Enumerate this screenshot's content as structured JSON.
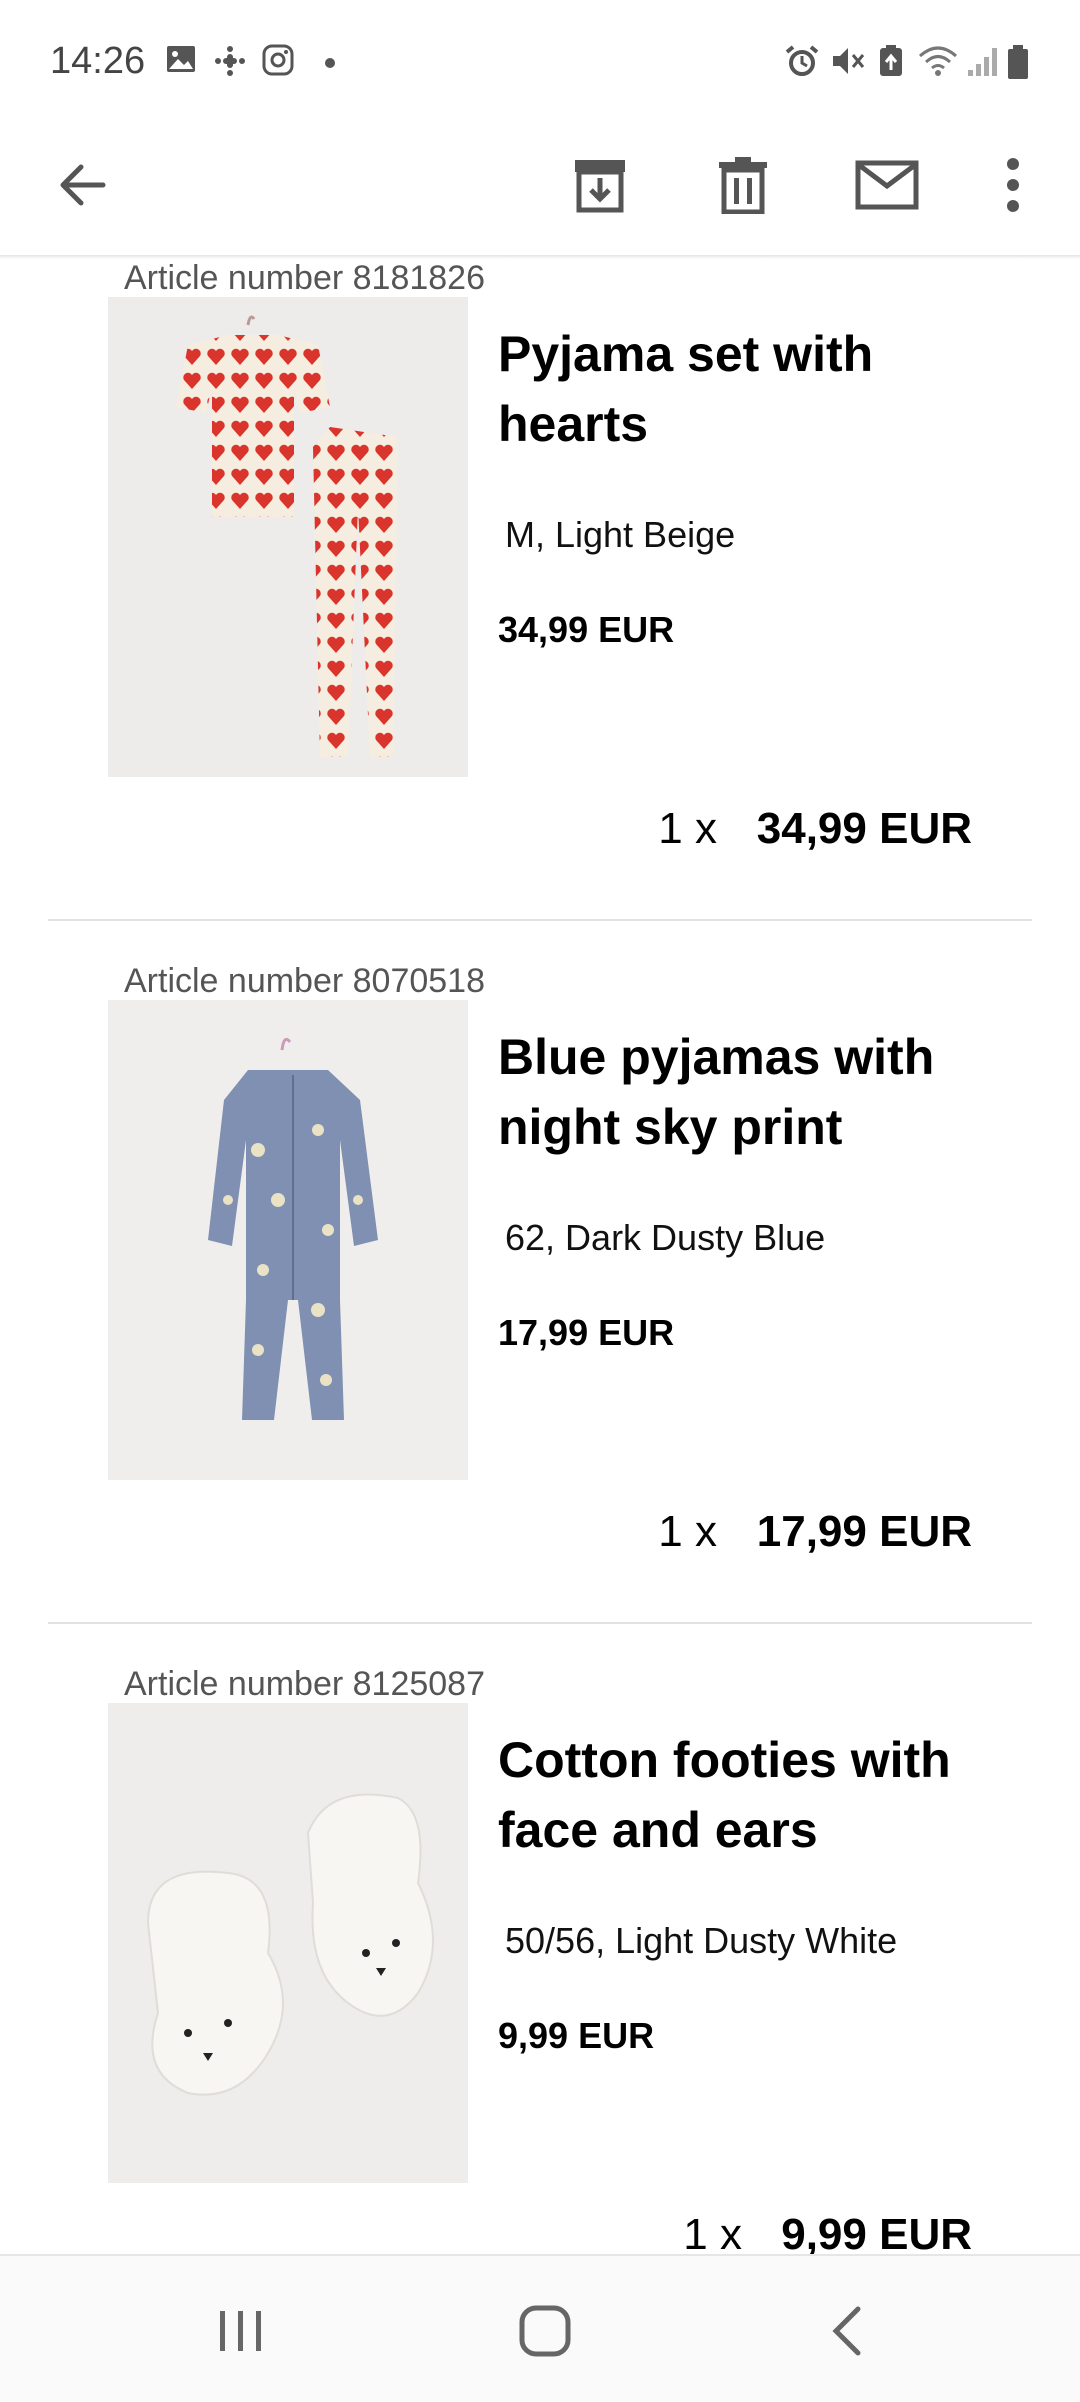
{
  "status_bar": {
    "time": "14:26",
    "left_icons": [
      "image-icon",
      "slack-icon",
      "instagram-icon",
      "dot-icon"
    ],
    "right_icons": [
      "alarm-icon",
      "mute-icon",
      "battery-saver-icon",
      "wifi-icon",
      "signal-icon",
      "battery-icon"
    ]
  },
  "toolbar": {
    "back_icon": "arrow-left-icon",
    "actions": [
      "archive-icon",
      "delete-icon",
      "mail-icon",
      "more-vert-icon"
    ]
  },
  "items": [
    {
      "article_number": "Article number 8181826",
      "title": "Pyjama set with hearts",
      "variant": "M, Light Beige",
      "unit_price": "34,99 EUR",
      "quantity": "1 x",
      "line_total": "34,99 EUR"
    },
    {
      "article_number": "Article number 8070518",
      "title": "Blue pyjamas with night sky print",
      "variant": "62, Dark Dusty Blue",
      "unit_price": "17,99 EUR",
      "quantity": "1 x",
      "line_total": "17,99 EUR"
    },
    {
      "article_number": "Article number 8125087",
      "title": "Cotton footies with face and ears",
      "variant": "50/56, Light Dusty White",
      "unit_price": "9,99 EUR",
      "quantity": "1 x",
      "line_total": "9,99 EUR"
    }
  ],
  "nav_bar": {
    "buttons": [
      "recent-apps-icon",
      "home-icon",
      "back-icon"
    ]
  },
  "colors": {
    "text": "#000000",
    "muted": "#555555",
    "divider": "#e2e2e2",
    "icon": "#555555"
  }
}
